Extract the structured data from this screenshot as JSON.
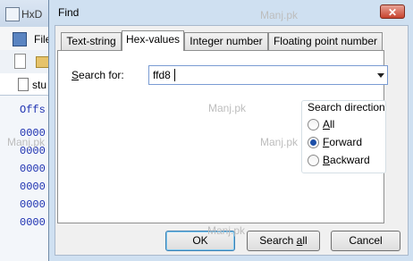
{
  "background_app": {
    "title": "HxD",
    "menu_file": "File",
    "file_tab": "stu",
    "column_header": "Offs",
    "hex_rows": [
      "0000",
      "0000",
      "0000",
      "0000",
      "0000",
      "0000"
    ]
  },
  "dialog": {
    "title": "Find",
    "close_label": "✕",
    "tabs": [
      {
        "label": "Text-string",
        "active": false
      },
      {
        "label": "Hex-values",
        "active": true
      },
      {
        "label": "Integer number",
        "active": false
      },
      {
        "label": "Floating point number",
        "active": false
      }
    ],
    "search": {
      "label_prefix": "S",
      "label_rest": "earch for:",
      "value": "ffd8"
    },
    "direction": {
      "title": "Search direction",
      "options": [
        {
          "mnemonic": "A",
          "rest": "ll",
          "checked": false
        },
        {
          "mnemonic": "F",
          "rest": "orward",
          "checked": true
        },
        {
          "mnemonic": "B",
          "rest": "ackward",
          "checked": false
        }
      ]
    },
    "buttons": {
      "ok": "OK",
      "search_all_prefix": "Search ",
      "search_all_mnemonic": "a",
      "search_all_rest": "ll",
      "cancel": "Cancel"
    }
  },
  "watermark": "Manj.pk"
}
